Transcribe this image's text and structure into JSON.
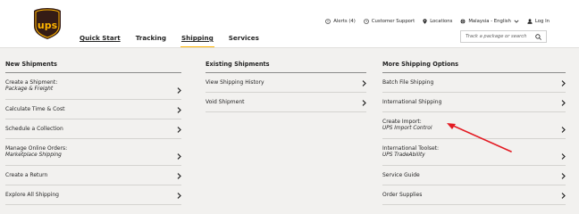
{
  "brand": {
    "logo_text": "ups",
    "logo_brown": "#351c15",
    "logo_gold": "#ffb500"
  },
  "nav": {
    "items": [
      {
        "label": "Quick Start",
        "name": "nav-quick-start"
      },
      {
        "label": "Tracking",
        "name": "nav-tracking"
      },
      {
        "label": "Shipping",
        "name": "nav-shipping"
      },
      {
        "label": "Services",
        "name": "nav-services"
      }
    ],
    "active": "Shipping"
  },
  "utility": {
    "alerts": "Alerts (4)",
    "customer_support": "Customer Support",
    "locations": "Locations",
    "language": "Malaysia - English",
    "login": "Log In"
  },
  "search": {
    "placeholder": "Track a package or search"
  },
  "columns": [
    {
      "heading": "New Shipments",
      "rows": [
        {
          "title": "Create a Shipment:",
          "subtitle": "Package & Freight"
        },
        {
          "title": "Calculate Time & Cost"
        },
        {
          "title": "Schedule a Collection"
        },
        {
          "title": "Manage Online Orders:",
          "subtitle": "Marketplace Shipping"
        },
        {
          "title": "Create a Return"
        },
        {
          "title": "Explore All Shipping"
        }
      ]
    },
    {
      "heading": "Existing Shipments",
      "rows": [
        {
          "title": "View Shipping History"
        },
        {
          "title": "Void Shipment"
        }
      ]
    },
    {
      "heading": "More Shipping Options",
      "rows": [
        {
          "title": "Batch File Shipping"
        },
        {
          "title": "International Shipping"
        },
        {
          "title": "Create Import:",
          "subtitle": "UPS Import Control"
        },
        {
          "title": "International Toolset:",
          "subtitle": "UPS TradeAbility"
        },
        {
          "title": "Service Guide"
        },
        {
          "title": "Order Supplies"
        }
      ]
    }
  ],
  "annotation": {
    "type": "arrow",
    "color": "#e31b23",
    "target": "Create Import: UPS Import Control"
  }
}
